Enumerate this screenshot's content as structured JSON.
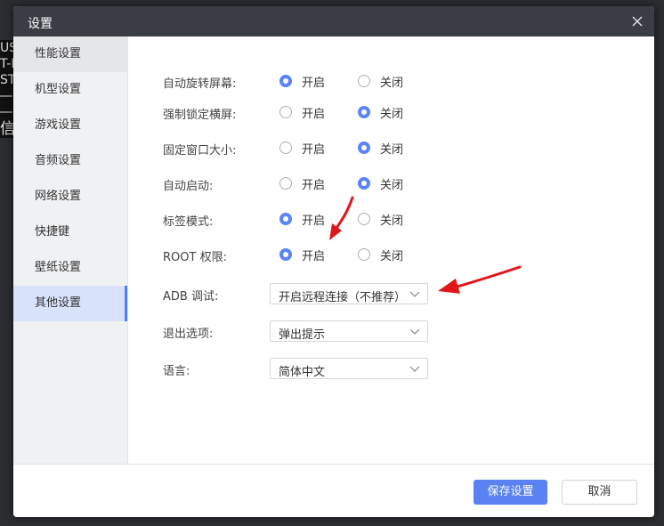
{
  "background": {
    "side_text": "US\nT-H\nSTI\n―\n―",
    "side_char": "信"
  },
  "dialog": {
    "title": "设置",
    "close_icon": "close-icon"
  },
  "sidebar": {
    "items": [
      {
        "label": "性能设置",
        "state": "hover"
      },
      {
        "label": "机型设置",
        "state": "normal"
      },
      {
        "label": "游戏设置",
        "state": "normal"
      },
      {
        "label": "音频设置",
        "state": "normal"
      },
      {
        "label": "网络设置",
        "state": "normal"
      },
      {
        "label": "快捷键",
        "state": "normal"
      },
      {
        "label": "壁纸设置",
        "state": "normal"
      },
      {
        "label": "其他设置",
        "state": "active"
      }
    ]
  },
  "settings": {
    "radio_rows": [
      {
        "label": "自动旋转屏幕:",
        "on_label": "开启",
        "off_label": "关闭",
        "selected": "on"
      },
      {
        "label": "强制锁定横屏:",
        "on_label": "开启",
        "off_label": "关闭",
        "selected": "off"
      },
      {
        "label": "固定窗口大小:",
        "on_label": "开启",
        "off_label": "关闭",
        "selected": "off"
      },
      {
        "label": "自动启动:",
        "on_label": "开启",
        "off_label": "关闭",
        "selected": "off"
      },
      {
        "label": "标签模式:",
        "on_label": "开启",
        "off_label": "关闭",
        "selected": "on"
      },
      {
        "label": "ROOT 权限:",
        "on_label": "开启",
        "off_label": "关闭",
        "selected": "on"
      }
    ],
    "select_rows": [
      {
        "label": "ADB 调试:",
        "value": "开启远程连接（不推荐）"
      },
      {
        "label": "退出选项:",
        "value": "弹出提示"
      },
      {
        "label": "语言:",
        "value": "简体中文"
      }
    ]
  },
  "footer": {
    "save_label": "保存设置",
    "cancel_label": "取消"
  },
  "colors": {
    "accent": "#5a82f3",
    "annotation_arrow": "#e0161b",
    "titlebar": "#3a3d44"
  }
}
